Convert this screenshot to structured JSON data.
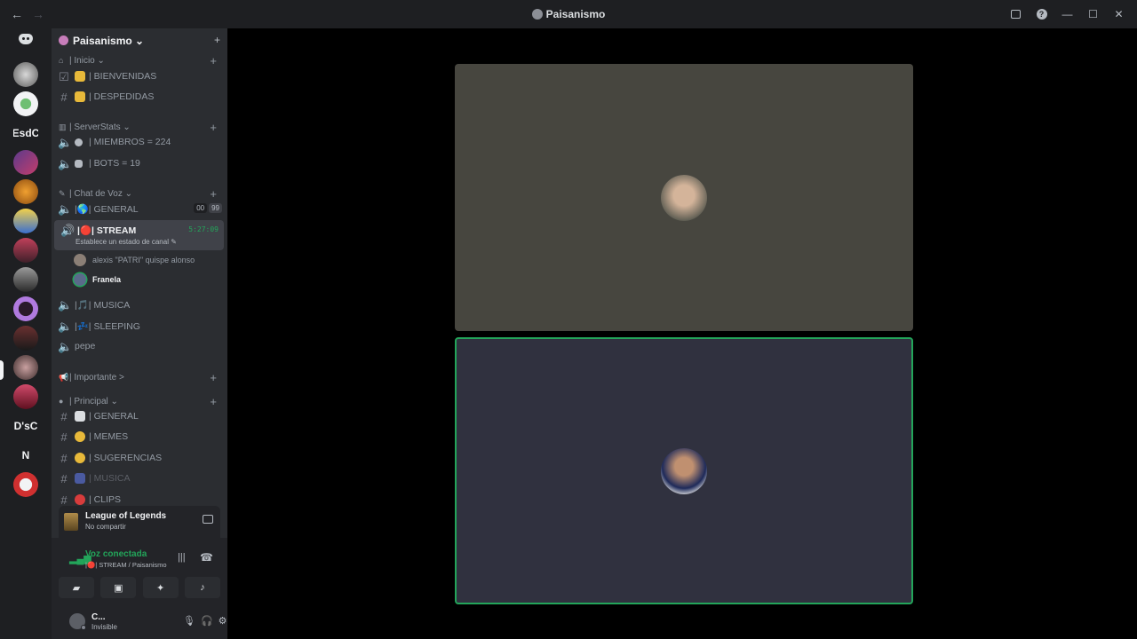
{
  "window": {
    "title": "Paisanismo",
    "nav_back": "←",
    "nav_forward": "→",
    "minimize": "—",
    "maximize": "☐",
    "close": "✕",
    "help": "?"
  },
  "guild_rail": {
    "text_guilds": [
      "EsdC",
      "D'sC",
      "N"
    ]
  },
  "server": {
    "name": "Paisanismo ⌄",
    "invite_icon": "+"
  },
  "categories": {
    "inicio": "| Inicio ⌄",
    "serverstats": "| ServerStats ⌄",
    "chat_de_voz": "| Chat de Voz ⌄",
    "importante": "| Importante >",
    "principal": "| Principal ⌄"
  },
  "channels": {
    "bienvenidas": "| BIENVENIDAS",
    "despedidas": "| DESPEDIDAS",
    "miembros": "| MIEMBROS = 224",
    "bots": "| BOTS = 19",
    "general_voice": "|🌎| GENERAL",
    "general_badge_a": "00",
    "general_badge_b": "99",
    "stream": "|🔴| STREAM",
    "stream_sub": "Establece un estado de canal ✎",
    "stream_time": "5:27:09",
    "musica_voice": "|🎵| MUSICA",
    "sleeping": "|💤| SLEEPING",
    "pepe": "pepe",
    "general_text": "| GENERAL",
    "memes": "| MEMES",
    "sugerencias": "| SUGERENCIAS",
    "musica_text": "| MUSICA",
    "clips": "| CLIPS"
  },
  "voice_users": [
    {
      "name": "alexis \"PATRI\" quispe alonso"
    },
    {
      "name": "Franela"
    }
  ],
  "activity": {
    "title": "League of Legends",
    "subtitle": "No compartir"
  },
  "voice_panel": {
    "status": "Voz conectada",
    "channel": "|🔴| STREAM / Paisanismo"
  },
  "user_panel": {
    "name": "C...",
    "status": "Invisible"
  },
  "colors": {
    "accent_green": "#23a55a",
    "sidebar_bg": "#2b2d31",
    "rail_bg": "#1e1f22",
    "tile_one_bg": "#47463f",
    "tile_two_bg": "#30313f"
  }
}
